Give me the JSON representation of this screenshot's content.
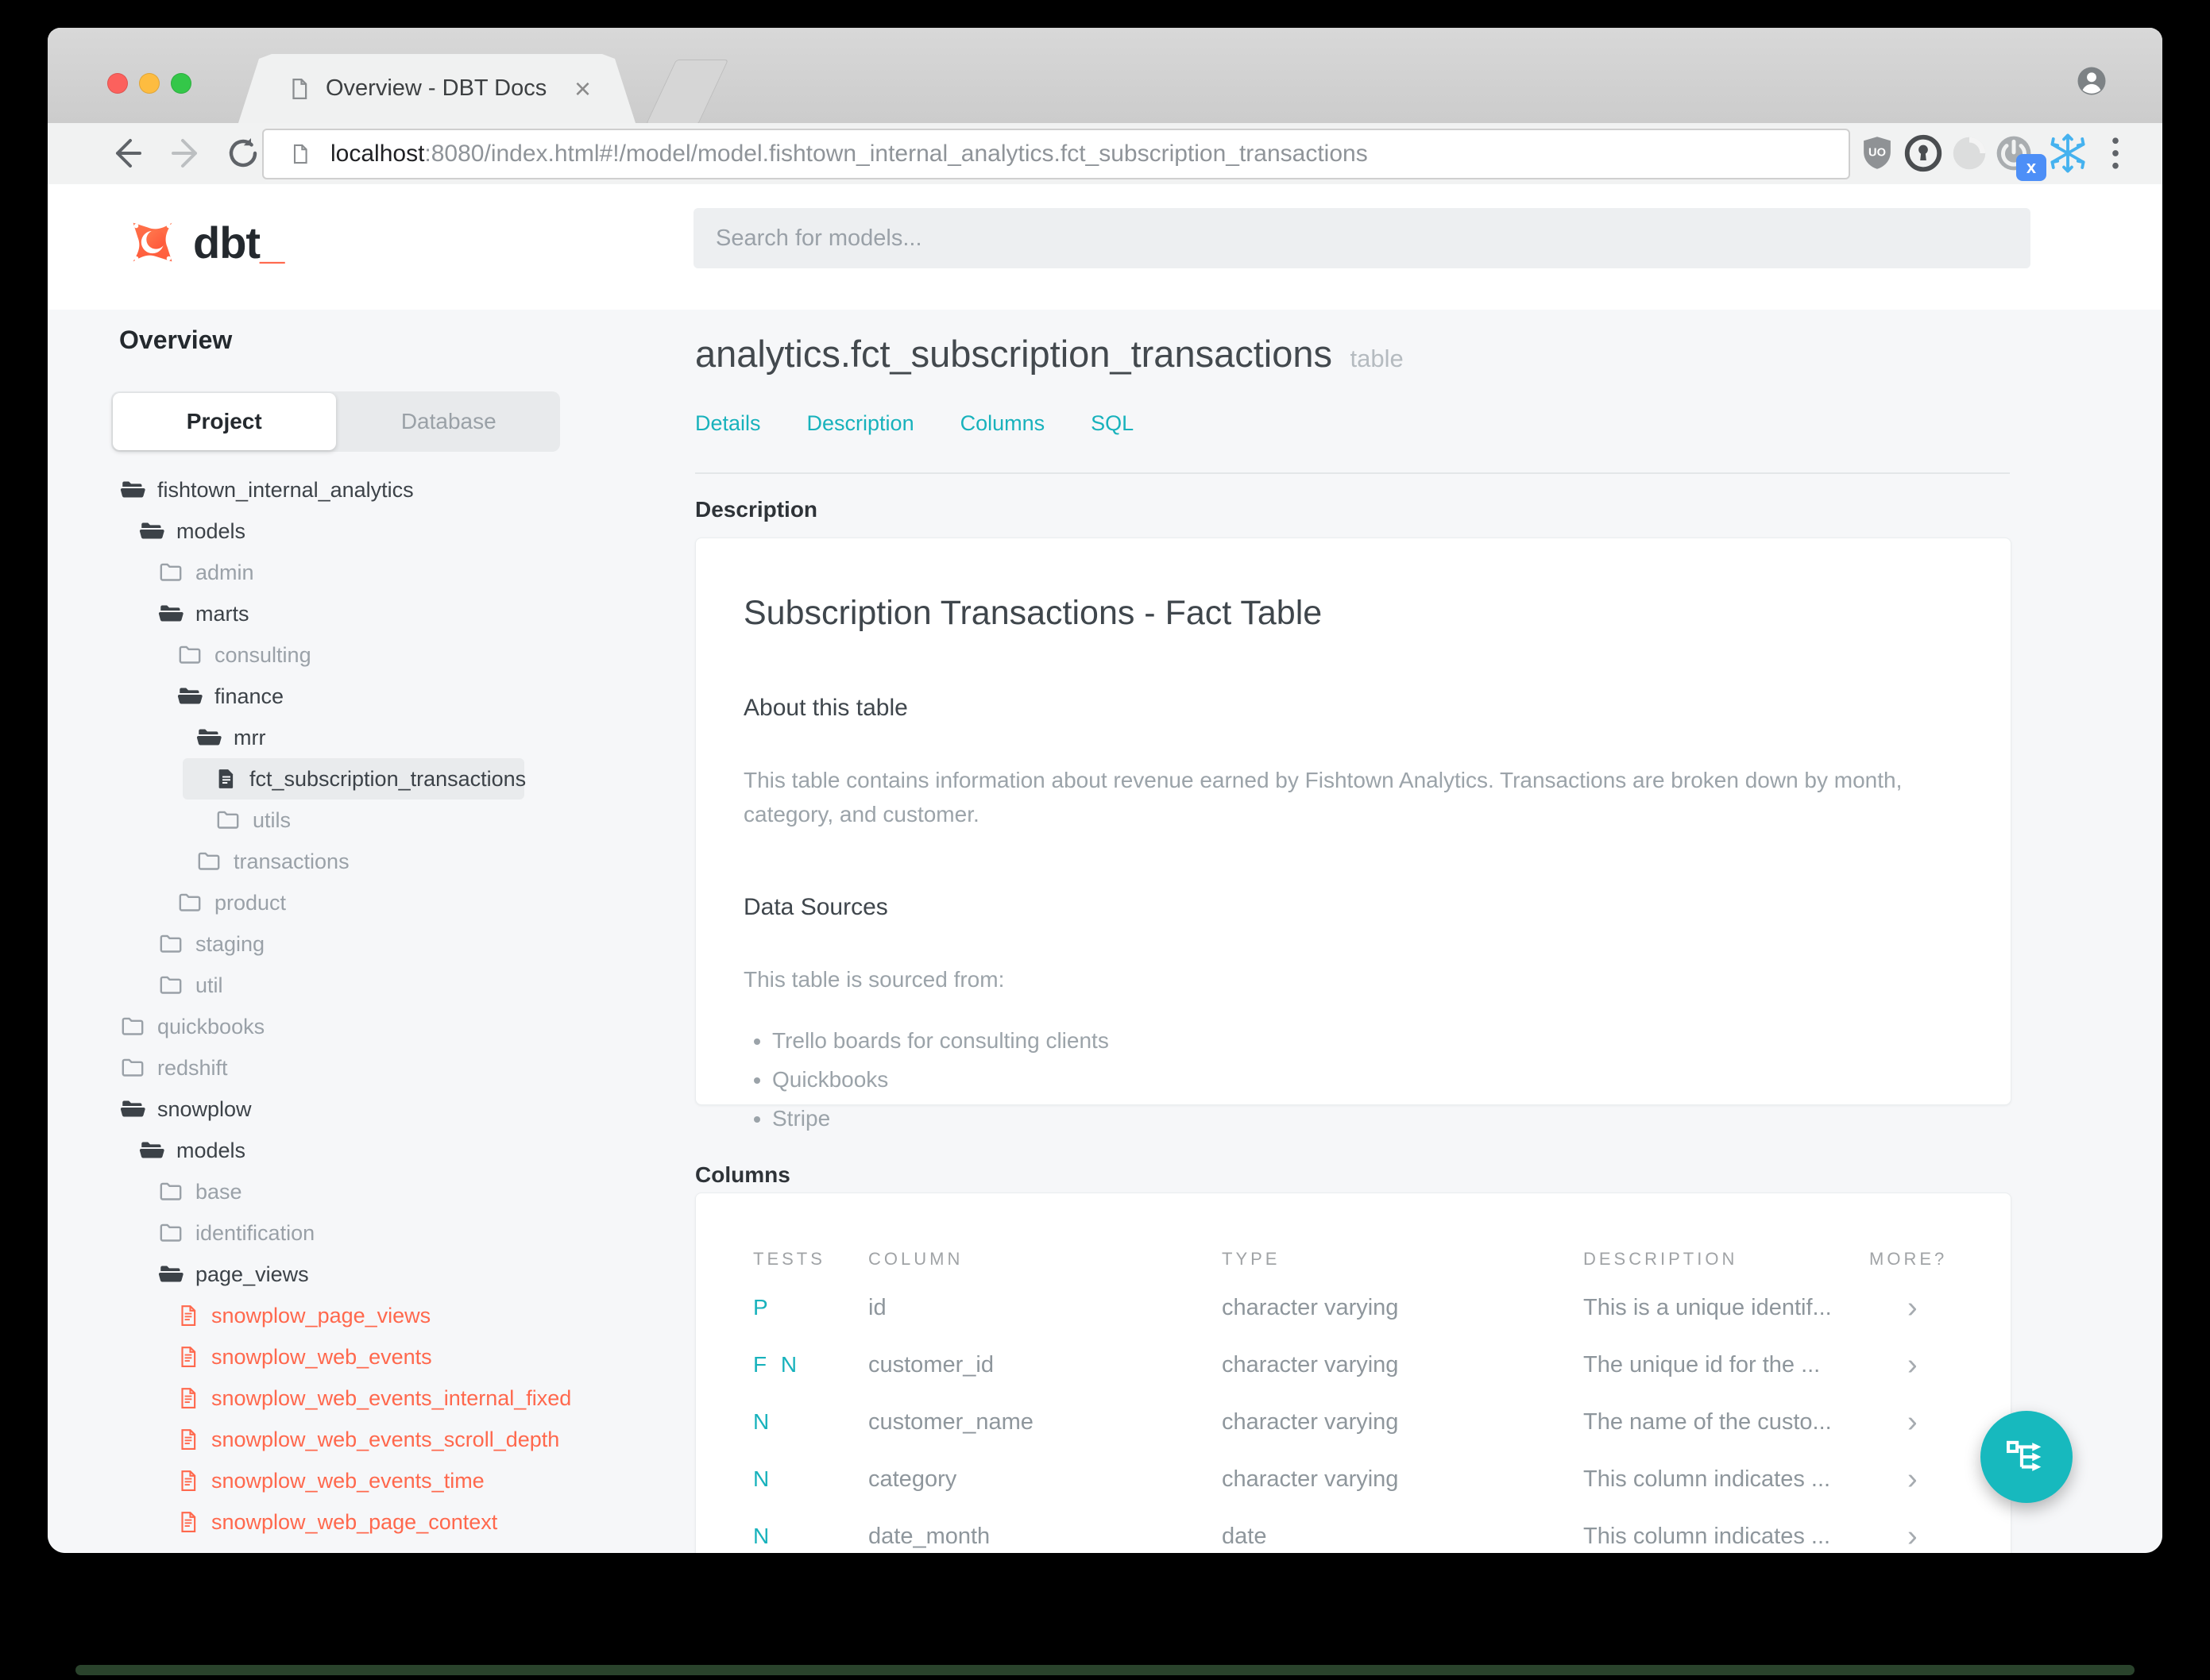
{
  "browser": {
    "tab_title": "Overview - DBT Docs",
    "tab_close": "×",
    "url_host": "localhost",
    "url_rest": ":8080/index.html#!/model/model.fishtown_internal_analytics.fct_subscription_transactions",
    "extension_badge": "x",
    "ublock_text": "UO"
  },
  "brand": {
    "name": "dbt",
    "underscore": "_",
    "orange": "#ff684d",
    "teal": "#18b2bc"
  },
  "appheader": {
    "search_placeholder": "Search for models..."
  },
  "sidebar": {
    "title": "Overview",
    "tabs": [
      {
        "label": "Project",
        "active": true
      },
      {
        "label": "Database",
        "active": false
      }
    ],
    "tree": [
      {
        "label": "fishtown_internal_analytics",
        "level": 0,
        "kind": "folder-open"
      },
      {
        "label": "models",
        "level": 1,
        "kind": "folder-open"
      },
      {
        "label": "admin",
        "level": 2,
        "kind": "folder-closed"
      },
      {
        "label": "marts",
        "level": 2,
        "kind": "folder-open"
      },
      {
        "label": "consulting",
        "level": 3,
        "kind": "folder-closed"
      },
      {
        "label": "finance",
        "level": 3,
        "kind": "folder-open"
      },
      {
        "label": "mrr",
        "level": 4,
        "kind": "folder-open"
      },
      {
        "label": "fct_subscription_transactions",
        "level": 5,
        "kind": "file",
        "selected": true
      },
      {
        "label": "utils",
        "level": 5,
        "kind": "folder-closed"
      },
      {
        "label": "transactions",
        "level": 4,
        "kind": "folder-closed"
      },
      {
        "label": "product",
        "level": 3,
        "kind": "folder-closed"
      },
      {
        "label": "staging",
        "level": 2,
        "kind": "folder-closed"
      },
      {
        "label": "util",
        "level": 2,
        "kind": "folder-closed"
      },
      {
        "label": "quickbooks",
        "level": 0,
        "kind": "folder-closed"
      },
      {
        "label": "redshift",
        "level": 0,
        "kind": "folder-closed"
      },
      {
        "label": "snowplow",
        "level": 0,
        "kind": "folder-open"
      },
      {
        "label": "models",
        "level": 1,
        "kind": "folder-open"
      },
      {
        "label": "base",
        "level": 2,
        "kind": "folder-closed"
      },
      {
        "label": "identification",
        "level": 2,
        "kind": "folder-closed"
      },
      {
        "label": "page_views",
        "level": 2,
        "kind": "folder-open"
      },
      {
        "label": "snowplow_page_views",
        "level": 3,
        "kind": "file-ref"
      },
      {
        "label": "snowplow_web_events",
        "level": 3,
        "kind": "file-ref"
      },
      {
        "label": "snowplow_web_events_internal_fixed",
        "level": 3,
        "kind": "file-ref"
      },
      {
        "label": "snowplow_web_events_scroll_depth",
        "level": 3,
        "kind": "file-ref"
      },
      {
        "label": "snowplow_web_events_time",
        "level": 3,
        "kind": "file-ref"
      },
      {
        "label": "snowplow_web_page_context",
        "level": 3,
        "kind": "file-ref"
      }
    ]
  },
  "main": {
    "title": "analytics.fct_subscription_transactions",
    "badge": "table",
    "nav": [
      "Details",
      "Description",
      "Columns",
      "SQL"
    ],
    "description_label": "Description",
    "doc": {
      "heading": "Subscription Transactions - Fact Table",
      "about_heading": "About this table",
      "about_text": "This table contains information about revenue earned by Fishtown Analytics. Transactions are broken down by month, category, and customer.",
      "sources_heading": "Data Sources",
      "sources_intro": "This table is sourced from:",
      "sources": [
        "Trello boards for consulting clients",
        "Quickbooks",
        "Stripe"
      ]
    },
    "columns_label": "Columns",
    "table": {
      "headers": [
        "TESTS",
        "COLUMN",
        "TYPE",
        "DESCRIPTION",
        "MORE?"
      ],
      "rows": [
        {
          "tests": "P",
          "column": "id",
          "type": "character varying",
          "description": "This is a unique identif...",
          "more": "›"
        },
        {
          "tests": "F N",
          "column": "customer_id",
          "type": "character varying",
          "description": "The unique id for the ...",
          "more": "›"
        },
        {
          "tests": "N",
          "column": "customer_name",
          "type": "character varying",
          "description": "The name of the custo...",
          "more": "›"
        },
        {
          "tests": "N",
          "column": "category",
          "type": "character varying",
          "description": "This column indicates ...",
          "more": "›"
        },
        {
          "tests": "N",
          "column": "date_month",
          "type": "date",
          "description": "This column indicates ...",
          "more": "›"
        }
      ]
    }
  }
}
